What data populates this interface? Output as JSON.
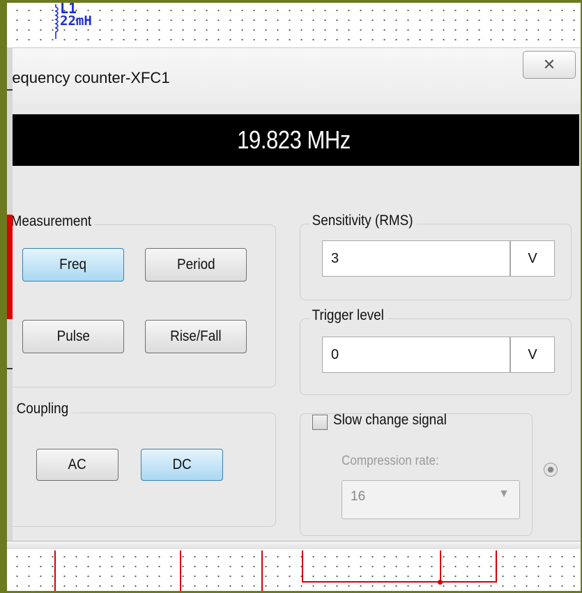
{
  "schematic": {
    "component_ref": "L1",
    "component_value": "22mH"
  },
  "window": {
    "title": "requency counter-XFC1",
    "close_icon": "close-icon"
  },
  "display": {
    "reading": "19.823 MHz"
  },
  "measurement": {
    "legend": "Measurement",
    "buttons": {
      "freq": "Freq",
      "period": "Period",
      "pulse": "Pulse",
      "rise_fall": "Rise/Fall"
    },
    "selected": "Freq"
  },
  "coupling": {
    "legend": "Coupling",
    "buttons": {
      "ac": "AC",
      "dc": "DC"
    },
    "selected": "DC"
  },
  "sensitivity": {
    "legend": "Sensitivity (RMS)",
    "value": "3",
    "unit": "V"
  },
  "trigger": {
    "legend": "Trigger level",
    "value": "0",
    "unit": "V"
  },
  "slow_change": {
    "label": "Slow change signal",
    "checked": false,
    "compression_label": "Compression rate:",
    "compression_value": "16"
  },
  "colors": {
    "frame": "#6b7a1f",
    "active_button": "#a9d8f2",
    "wire": "#d40000",
    "component_label": "#1a2dd6"
  }
}
